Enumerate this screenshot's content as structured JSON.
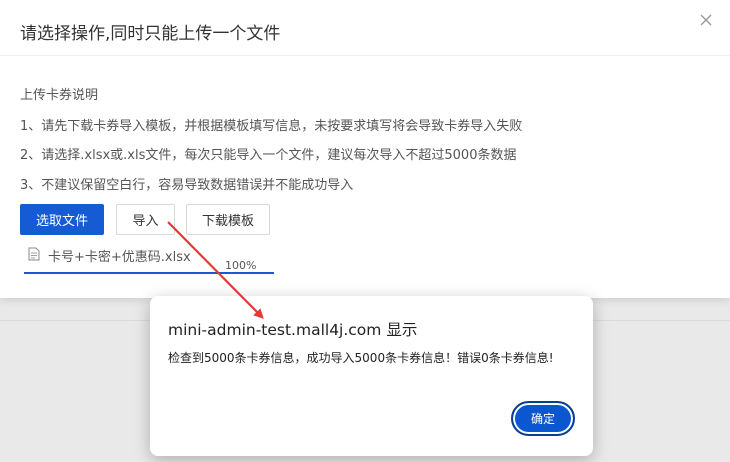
{
  "dialog": {
    "title": "请选择操作,同时只能上传一个文件",
    "instructions": [
      "上传卡券说明",
      "1、请先下载卡券导入模板，并根据模板填写信息，未按要求填写将会导致卡券导入失败",
      "2、请选择.xlsx或.xls文件，每次只能导入一个文件，建议每次导入不超过5000条数据",
      "3、不建议保留空白行，容易导致数据错误并不能成功导入"
    ],
    "buttons": {
      "select_file": "选取文件",
      "import": "导入",
      "download_template": "下载模板"
    },
    "file": {
      "name": "卡号+卡密+优惠码.xlsx",
      "progress_text": "100%",
      "progress": 1.0
    }
  },
  "alert": {
    "title": "mini-admin-test.mall4j.com 显示",
    "message": "检查到5000条卡券信息，成功导入5000条卡券信息！错误0条卡券信息!",
    "ok_label": "确定"
  },
  "colors": {
    "primary": "#155bd4",
    "annotation": "#e53935"
  }
}
